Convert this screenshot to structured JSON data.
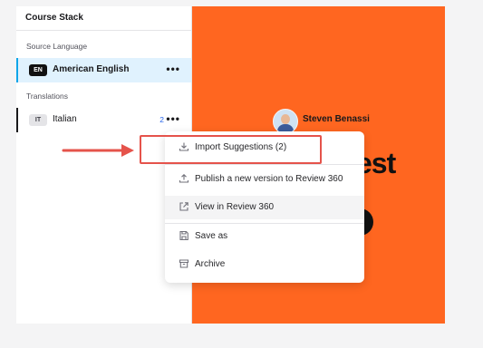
{
  "sidebar": {
    "title": "Course Stack",
    "source_label": "Source Language",
    "source": {
      "code": "EN",
      "name": "American English"
    },
    "translations_label": "Translations",
    "translations": [
      {
        "code": "IT",
        "name": "Italian",
        "count": "2"
      }
    ],
    "more_glyph": "•••"
  },
  "preview": {
    "presenter_name": "Steven Benassi",
    "title_fragment": "est"
  },
  "menu": {
    "items": [
      {
        "label": "Import Suggestions (2)",
        "icon": "download-icon"
      },
      {
        "label": "Publish a new version to Review 360",
        "icon": "upload-icon"
      },
      {
        "label": "View in Review 360",
        "icon": "external-link-icon"
      },
      {
        "label": "Save as",
        "icon": "save-icon"
      },
      {
        "label": "Archive",
        "icon": "archive-icon"
      }
    ]
  },
  "colors": {
    "accent": "#0ea5e9",
    "preview_bg": "#ff6620",
    "annotation": "#e5534b"
  }
}
